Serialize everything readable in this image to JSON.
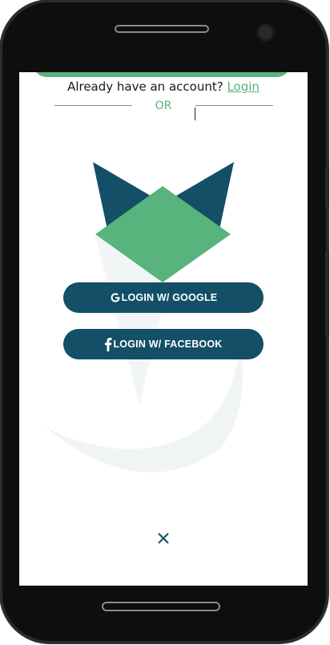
{
  "auth": {
    "already_text": "Already have an account?",
    "login_link": "Login",
    "or_text": "OR"
  },
  "buttons": {
    "google_label": "LOGIN W/ GOOGLE",
    "facebook_label": "LOGIN W/ FACEBOOK"
  },
  "icons": {
    "google": "google-g-icon",
    "facebook": "facebook-f-icon",
    "close": "close-icon"
  },
  "colors": {
    "accent_green": "#58b37c",
    "button_dark": "#134f66",
    "logo_ear": "#134f66",
    "logo_diamond": "#58b37c"
  }
}
